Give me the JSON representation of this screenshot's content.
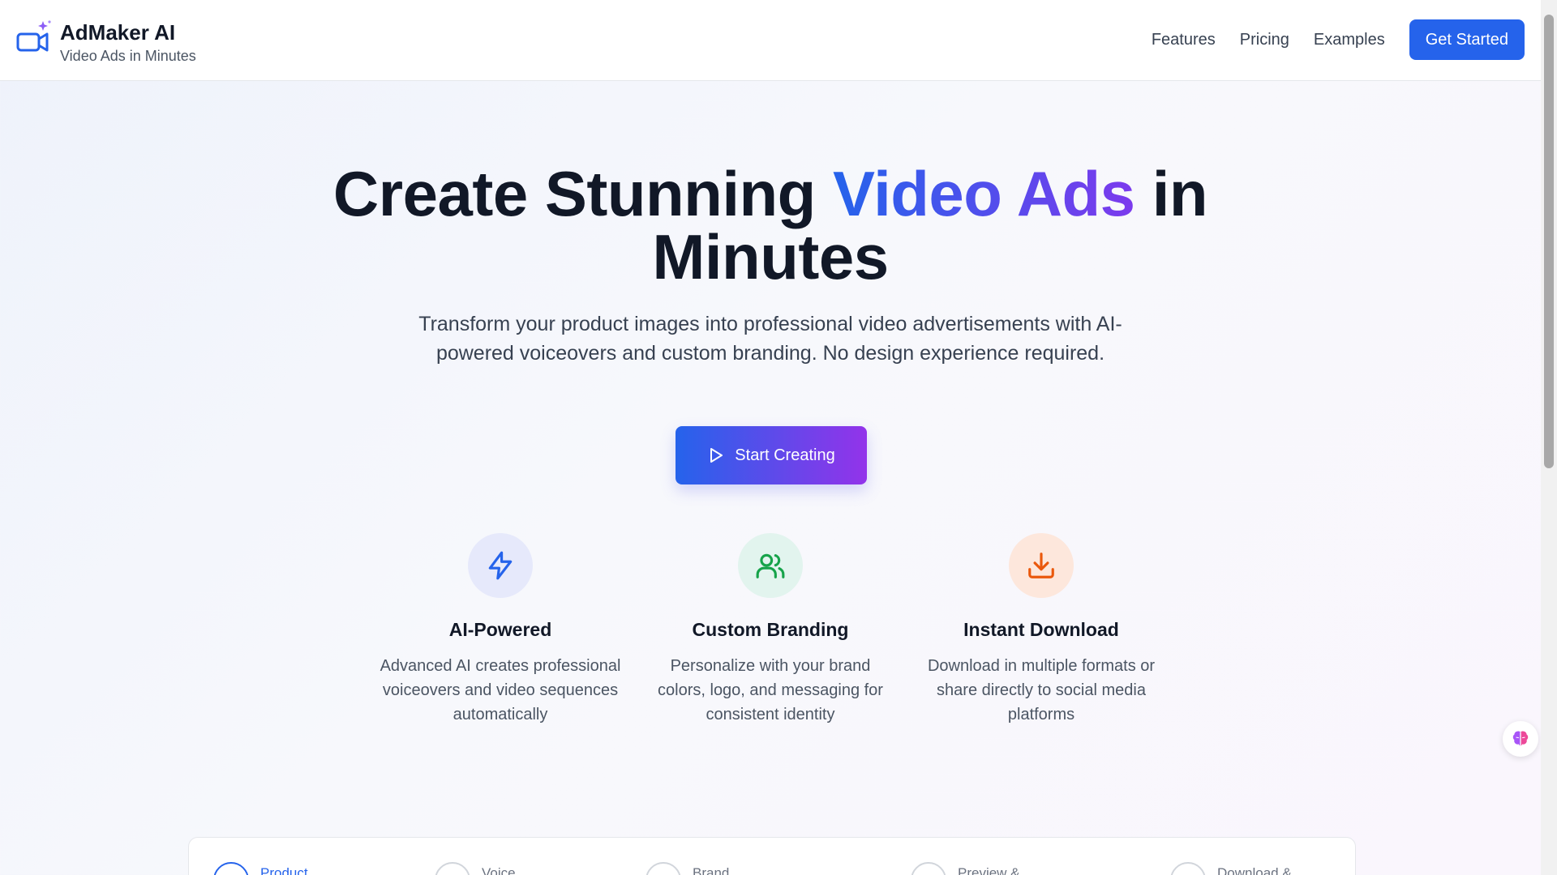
{
  "brand": {
    "title": "AdMaker AI",
    "subtitle": "Video Ads in Minutes",
    "icon": "video-camera-sparkle-icon"
  },
  "nav": {
    "items": [
      {
        "label": "Features"
      },
      {
        "label": "Pricing"
      },
      {
        "label": "Examples"
      }
    ],
    "cta_label": "Get Started"
  },
  "hero": {
    "title_part1": "Create Stunning ",
    "title_highlight": "Video Ads",
    "title_part2": " in",
    "title_line2": "Minutes",
    "description": "Transform your product images into professional video advertisements with AI-powered voiceovers and custom branding. No design experience required.",
    "start_label": "Start Creating"
  },
  "features": [
    {
      "icon": "lightning-bolt-icon",
      "title": "AI-Powered",
      "description": "Advanced AI creates professional voiceovers and video sequences automatically",
      "icon_color": "#2563eb",
      "bg_color": "#e6e9fb"
    },
    {
      "icon": "users-icon",
      "title": "Custom Branding",
      "description": "Personalize with your brand colors, logo, and messaging for consistent identity",
      "icon_color": "#16a34a",
      "bg_color": "#e2f4ee"
    },
    {
      "icon": "download-icon",
      "title": "Instant Download",
      "description": "Download in multiple formats or share directly to social media platforms",
      "icon_color": "#ea580c",
      "bg_color": "#fde7dc"
    }
  ],
  "steps": [
    {
      "label": "Product",
      "active": true
    },
    {
      "label": "Voice",
      "active": false
    },
    {
      "label": "Brand",
      "active": false
    },
    {
      "label": "Preview &",
      "active": false
    },
    {
      "label": "Download &",
      "active": false
    }
  ],
  "colors": {
    "accent": "#2563eb",
    "gradient_start": "#2563eb",
    "gradient_end": "#9333ea"
  },
  "floating_button_icon": "brain-icon"
}
